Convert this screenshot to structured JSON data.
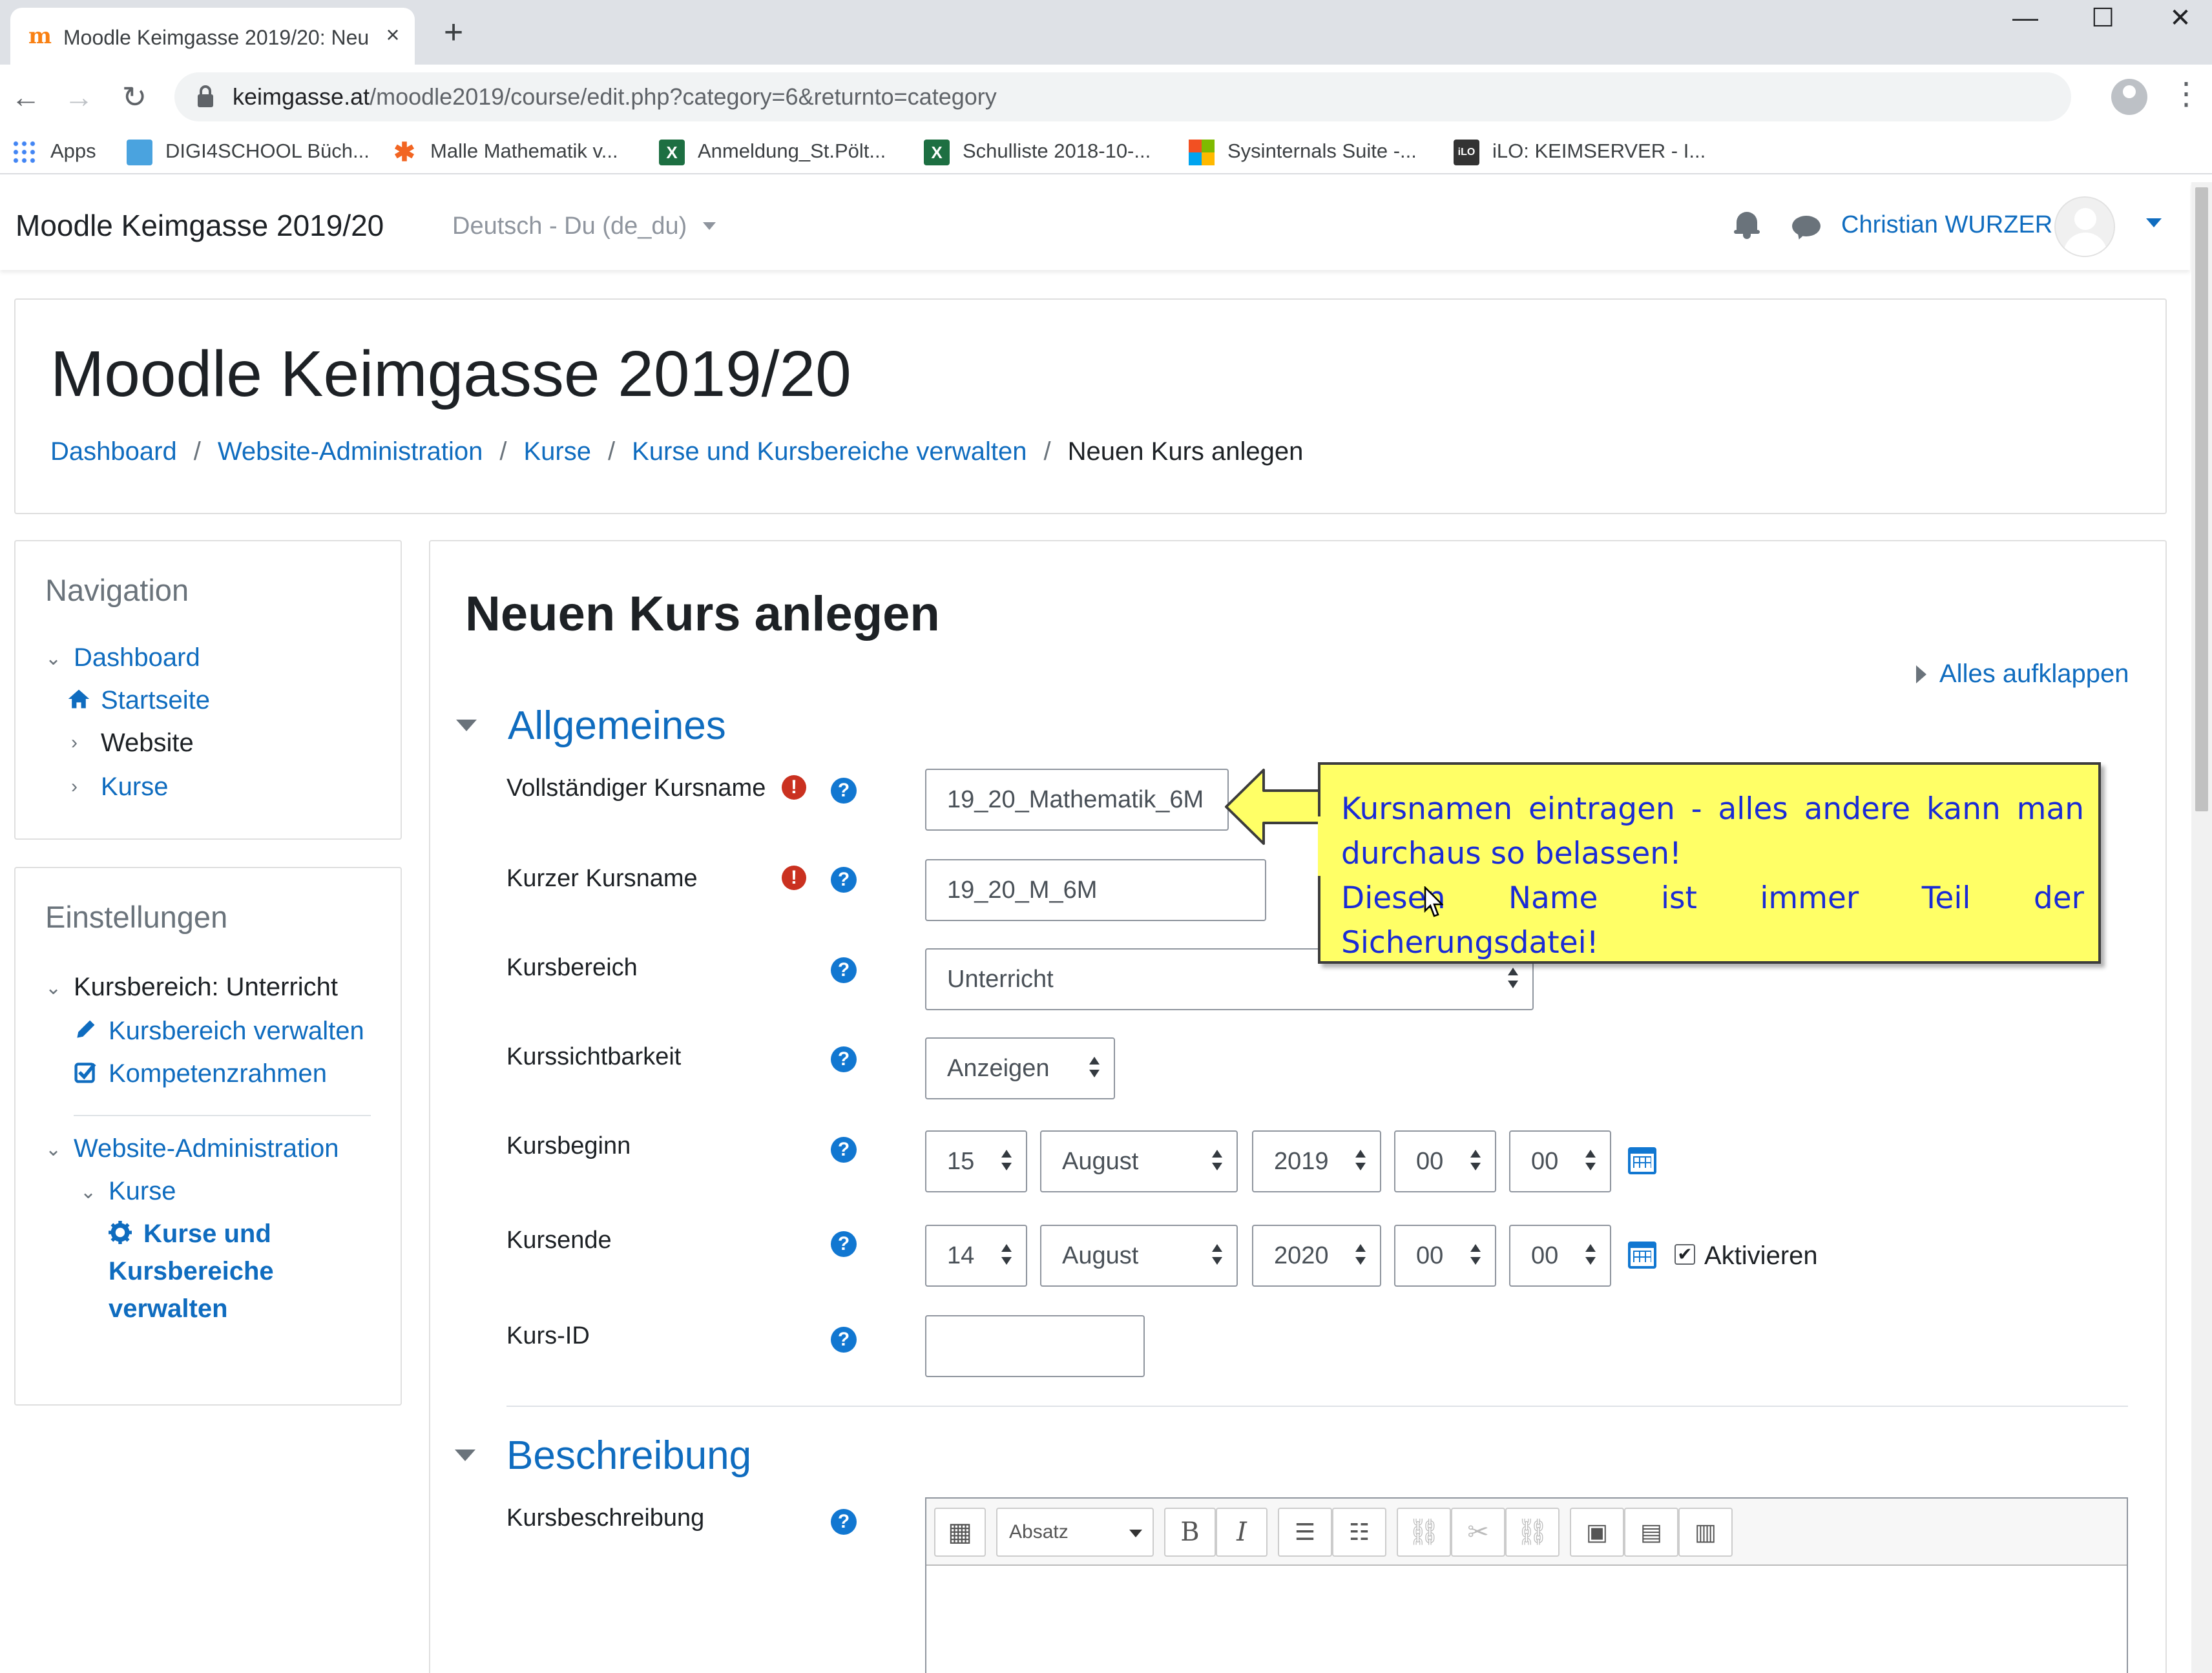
{
  "browser": {
    "tab_title": "Moodle Keimgasse 2019/20: Neu",
    "tab_close": "×",
    "new_tab": "+",
    "window_controls": {
      "minimize": "—",
      "maximize": "☐",
      "close": "✕"
    },
    "url_host": "keimgasse.at",
    "url_path": "/moodle2019/course/edit.php?category=6&returnto=category",
    "bookmarks": [
      {
        "label": "Apps",
        "icon": "apps-grid-icon"
      },
      {
        "label": "DIGI4SCHOOL Büch...",
        "icon": "digi4school-icon"
      },
      {
        "label": "Malle Mathematik v...",
        "icon": "malle-icon"
      },
      {
        "label": "Anmeldung_St.Pölt...",
        "icon": "excel-icon"
      },
      {
        "label": "Schulliste 2018-10-...",
        "icon": "excel-icon"
      },
      {
        "label": "Sysinternals Suite -...",
        "icon": "microsoft-icon"
      },
      {
        "label": "iLO: KEIMSERVER - I...",
        "icon": "ilo-icon"
      }
    ]
  },
  "navbar": {
    "brand": "Moodle Keimgasse 2019/20",
    "language": "Deutsch - Du (de_du)",
    "user_name": "Christian WURZER"
  },
  "header": {
    "title": "Moodle Keimgasse 2019/20",
    "breadcrumb": [
      "Dashboard",
      "Website-Administration",
      "Kurse",
      "Kurse und Kursbereiche verwalten",
      "Neuen Kurs anlegen"
    ],
    "separator": "/"
  },
  "nav_block": {
    "title": "Navigation",
    "items": [
      "Dashboard",
      "Startseite",
      "Website",
      "Kurse"
    ]
  },
  "settings_block": {
    "title": "Einstellungen",
    "items": [
      "Kursbereich: Unterricht",
      "Kursbereich verwalten",
      "Kompetenzrahmen",
      "Website-Administration",
      "Kurse",
      "Kurse und",
      "Kursbereiche",
      "verwalten"
    ]
  },
  "main": {
    "title": "Neuen Kurs anlegen",
    "expand_all": "Alles aufklappen",
    "section_general": "Allgemeines",
    "section_description": "Beschreibung",
    "fields": {
      "fullname_label": "Vollständiger Kursname",
      "fullname_value": "19_20_Mathematik_6M",
      "shortname_label": "Kurzer Kursname",
      "shortname_value": "19_20_M_6M",
      "category_label": "Kursbereich",
      "category_value": "Unterricht",
      "visibility_label": "Kurssichtbarkeit",
      "visibility_value": "Anzeigen",
      "start_label": "Kursbeginn",
      "start": {
        "day": "15",
        "month": "August",
        "year": "2019",
        "hour": "00",
        "minute": "00"
      },
      "end_label": "Kursende",
      "end": {
        "day": "14",
        "month": "August",
        "year": "2020",
        "hour": "00",
        "minute": "00"
      },
      "end_enable_label": "Aktivieren",
      "end_enabled": true,
      "idnumber_label": "Kurs-ID",
      "idnumber_value": "",
      "summary_label": "Kursbeschreibung"
    },
    "editor": {
      "format_select": "Absatz",
      "bold": "B",
      "italic": "I"
    },
    "required_glyph": "!",
    "help_glyph": "?",
    "check_glyph": "✔"
  },
  "callout": {
    "line1": "Kursnamen eintragen - alles andere kann man durchaus so belassen!",
    "line2": "Diesen Name ist immer Teil der Sicherungsdatei!",
    "bg_color": "#ffff66",
    "text_color": "#1a2bd6"
  },
  "colors": {
    "link": "#0f6cbf",
    "help_icon": "#1177d1",
    "required_icon": "#ca3120"
  }
}
